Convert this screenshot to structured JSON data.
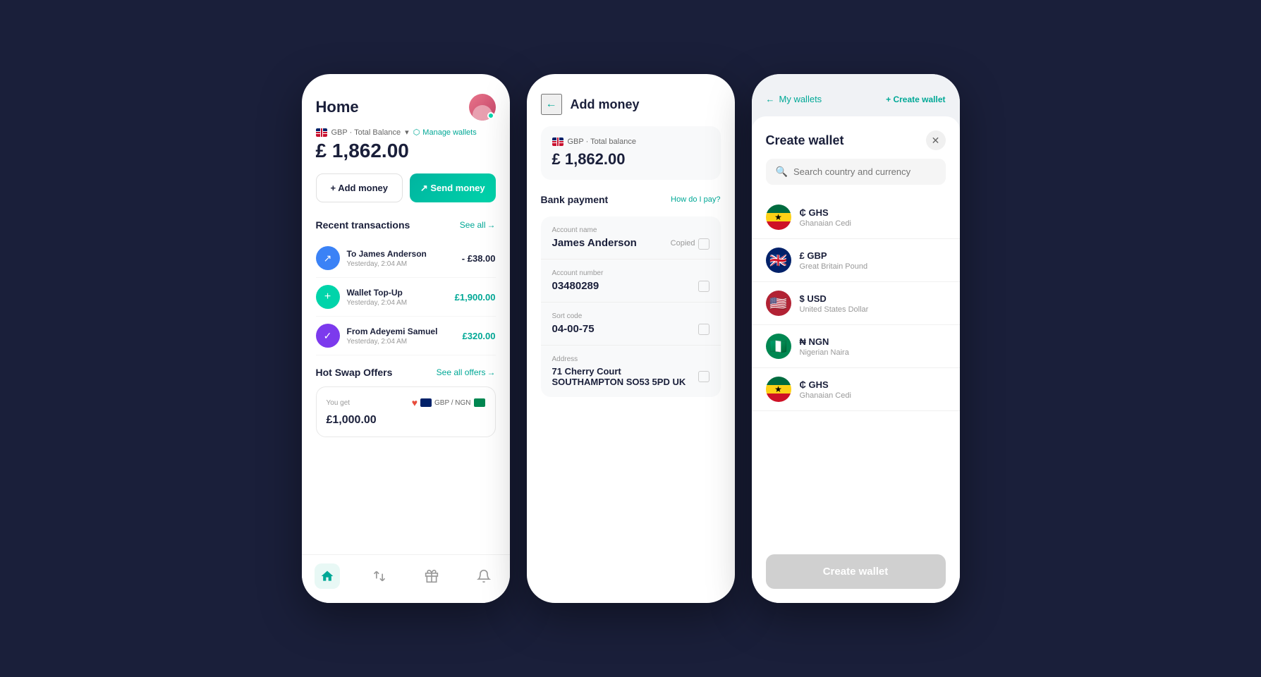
{
  "background": "#1a1f3a",
  "phone1": {
    "title": "Home",
    "balance_label": "GBP · Total Balance",
    "balance_amount": "£ 1,862.00",
    "manage_wallets": "Manage wallets",
    "add_money": "+ Add money",
    "send_money": "↗ Send money",
    "recent_transactions": "Recent transactions",
    "see_all": "See all",
    "transactions": [
      {
        "name": "To James Anderson",
        "date": "Yesterday, 2:04 AM",
        "amount": "- £38.00",
        "type": "send"
      },
      {
        "name": "Wallet Top-Up",
        "date": "Yesterday, 2:04 AM",
        "amount": "£1,900.00",
        "type": "topup"
      },
      {
        "name": "From Adeyemi Samuel",
        "date": "Yesterday, 2:04 AM",
        "amount": "£320.00",
        "type": "receive"
      }
    ],
    "hot_swap_title": "Hot Swap Offers",
    "see_all_offers": "See all offers",
    "swap_label": "You get",
    "swap_amount": "£1,000.00",
    "swap_pair": "GBP / NGN",
    "nav_items": [
      "home",
      "exchange",
      "gift",
      "notification"
    ]
  },
  "phone2": {
    "title": "Add money",
    "balance_label": "GBP · Total balance",
    "balance_amount": "£ 1,862.00",
    "bank_payment": "Bank payment",
    "how_do_i_pay": "How do I pay?",
    "account_name_label": "Account name",
    "account_name": "James Anderson",
    "copied": "Copied",
    "account_number_label": "Account number",
    "account_number": "03480289",
    "sort_code_label": "Sort code",
    "sort_code": "04-00-75",
    "address_label": "Address",
    "address_line1": "71 Cherry Court",
    "address_line2": "SOUTHAMPTON SO53 5PD UK"
  },
  "phone3": {
    "back_label": "My wallets",
    "create_link": "+ Create wallet",
    "modal_title": "Create wallet",
    "search_placeholder": "Search country and currency",
    "currencies": [
      {
        "symbol": "₵ GHS",
        "name": "Ghanaian Cedi",
        "flag_type": "gh"
      },
      {
        "symbol": "£ GBP",
        "name": "Great Britain Pound",
        "flag_type": "uk"
      },
      {
        "symbol": "$ USD",
        "name": "United States Dollar",
        "flag_type": "us"
      },
      {
        "symbol": "₦ NGN",
        "name": "Nigerian Naira",
        "flag_type": "ng"
      },
      {
        "symbol": "₵ GHS",
        "name": "Ghanaian Cedi",
        "flag_type": "gh"
      }
    ],
    "create_btn": "Create wallet"
  }
}
